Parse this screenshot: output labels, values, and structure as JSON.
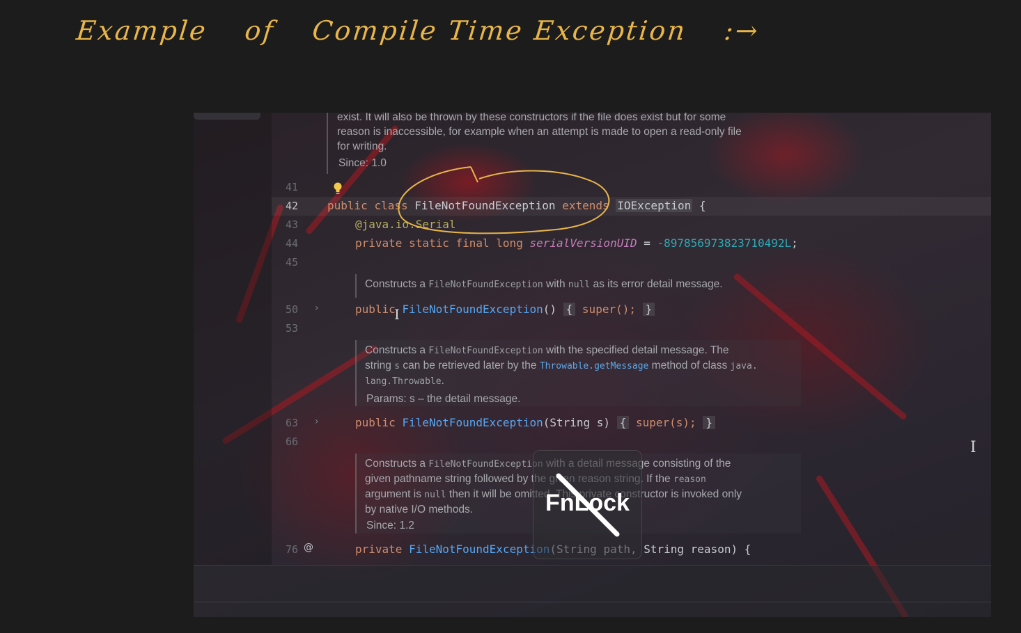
{
  "annotation": {
    "words": [
      "Example",
      "of",
      "Compile Time Exception",
      ":→"
    ],
    "color": "#e8b54a"
  },
  "editor": {
    "top_doc": {
      "lines": [
        "exist. It will also be thrown by these constructors if the file does exist but for some",
        "reason is inaccessible, for example when an attempt is made to open a read-only file",
        "for writing."
      ],
      "since": "Since: 1.0"
    },
    "line_numbers": [
      "41",
      "42",
      "43",
      "44",
      "45",
      "50",
      "53",
      "63",
      "66",
      "76"
    ],
    "line42": {
      "kw1": "public",
      "kw2": "class",
      "name": "FileNotFoundException",
      "kw3": "extends",
      "super": "IOException",
      "brace": "{"
    },
    "line43": {
      "annotation": "@java.io.Serial"
    },
    "line44": {
      "mods": "private static final long",
      "field": "serialVersionUID",
      "eq": " = ",
      "value": "-897856973823710492L",
      "semi": ";"
    },
    "doc1": {
      "pre": "Constructs a ",
      "code1": "FileNotFoundException",
      "mid": " with ",
      "code2": "null",
      "post": " as its error detail message."
    },
    "line50": {
      "kw": "public",
      "name": "FileNotFoundException",
      "paren": "()",
      "open": "{",
      "body": "super();",
      "close": "}"
    },
    "doc2": {
      "l1_pre": "Constructs a ",
      "l1_code": "FileNotFoundException",
      "l1_post": " with the specified detail message. The",
      "l2_pre": "string ",
      "l2_code": "s",
      "l2_mid": " can be retrieved later by the ",
      "l2_link": "Throwable.getMessage",
      "l2_post": " method of class ",
      "l2_code2": "java.",
      "l3_code": "lang.Throwable",
      "l3_post": ".",
      "params": "Params: s – the detail message."
    },
    "line63": {
      "kw": "public",
      "name": "FileNotFoundException",
      "args": "(String s)",
      "open": "{",
      "body": "super(s);",
      "close": "}"
    },
    "doc3": {
      "l1_pre": "Constructs a ",
      "l1_code": "FileNotFoundException",
      "l1_post": " with a detail message consisting of the",
      "l2_pre": "given pathname string followed by the given reason string. If the ",
      "l2_code": "reason",
      "l3_pre": "argument is ",
      "l3_code": "null",
      "l3_post": " then it will be omitted. This private constructor is invoked only",
      "l4": "by native I/O methods.",
      "since": "Since: 1.2"
    },
    "line76": {
      "marker": "@",
      "kw": "private",
      "name": "FileNotFoundException",
      "args": "(String path, String reason) {"
    }
  },
  "overlay": {
    "label": "FnLock"
  }
}
